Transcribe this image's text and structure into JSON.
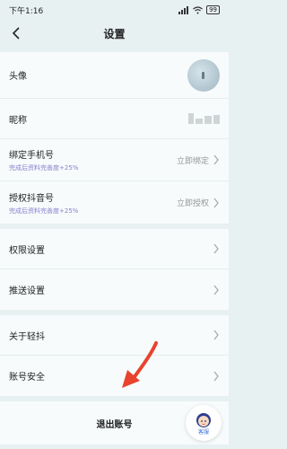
{
  "status_bar": {
    "time": "下午1:16",
    "battery": "99"
  },
  "header": {
    "title": "设置"
  },
  "profile": {
    "avatar_label": "头像",
    "nickname_label": "昵称"
  },
  "bind_phone": {
    "label": "绑定手机号",
    "sub": "完成后资料完善度+25%",
    "action": "立即绑定"
  },
  "auth_douyin": {
    "label": "授权抖音号",
    "sub": "完成后资料完善度+25%",
    "action": "立即授权"
  },
  "permission": {
    "label": "权限设置"
  },
  "push": {
    "label": "推送设置"
  },
  "about": {
    "label": "关于轻抖"
  },
  "security": {
    "label": "账号安全"
  },
  "logout": {
    "label": "退出账号"
  },
  "service": {
    "label": "客服"
  },
  "colors": {
    "accent_sub": "#8a7fcf",
    "arrow": "#e8432d",
    "service": "#3a6fd6"
  }
}
